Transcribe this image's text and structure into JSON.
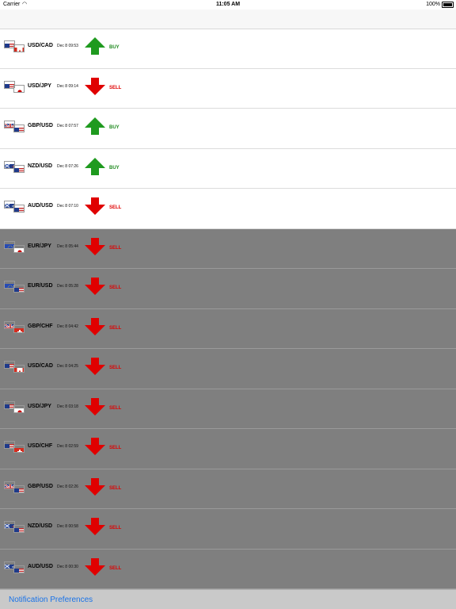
{
  "status": {
    "carrier": "Carrier",
    "time": "11:05 AM",
    "battery": "100%"
  },
  "signals": [
    {
      "pair": "USD/CAD",
      "time": "Dec 8 09:53",
      "signal": "BUY",
      "flags": [
        "us",
        "ca"
      ]
    },
    {
      "pair": "USD/JPY",
      "time": "Dec 8 09:14",
      "signal": "SELL",
      "flags": [
        "us",
        "jp"
      ]
    },
    {
      "pair": "GBP/USD",
      "time": "Dec 8 07:57",
      "signal": "BUY",
      "flags": [
        "gb",
        "us"
      ]
    },
    {
      "pair": "NZD/USD",
      "time": "Dec 8 07:26",
      "signal": "BUY",
      "flags": [
        "nz",
        "us"
      ]
    },
    {
      "pair": "AUD/USD",
      "time": "Dec 8 07:10",
      "signal": "SELL",
      "flags": [
        "au",
        "us"
      ]
    },
    {
      "pair": "EUR/JPY",
      "time": "Dec 8 05:44",
      "signal": "SELL",
      "flags": [
        "eu",
        "jp"
      ]
    },
    {
      "pair": "EUR/USD",
      "time": "Dec 8 05:28",
      "signal": "SELL",
      "flags": [
        "eu",
        "us"
      ]
    },
    {
      "pair": "GBP/CHF",
      "time": "Dec 8 04:42",
      "signal": "SELL",
      "flags": [
        "gb",
        "ch"
      ]
    },
    {
      "pair": "USD/CAD",
      "time": "Dec 8 04:25",
      "signal": "SELL",
      "flags": [
        "us",
        "ca"
      ]
    },
    {
      "pair": "USD/JPY",
      "time": "Dec 8 03:18",
      "signal": "SELL",
      "flags": [
        "us",
        "jp"
      ]
    },
    {
      "pair": "USD/CHF",
      "time": "Dec 8 02:59",
      "signal": "SELL",
      "flags": [
        "us",
        "ch"
      ]
    },
    {
      "pair": "GBP/USD",
      "time": "Dec 8 02:26",
      "signal": "SELL",
      "flags": [
        "gb",
        "us"
      ]
    },
    {
      "pair": "NZD/USD",
      "time": "Dec 8 00:58",
      "signal": "SELL",
      "flags": [
        "nz",
        "us"
      ]
    },
    {
      "pair": "AUD/USD",
      "time": "Dec 8 00:30",
      "signal": "SELL",
      "flags": [
        "au",
        "us"
      ]
    }
  ],
  "dimmed_from_index": 5,
  "colors": {
    "buy": "#1f9a1f",
    "sell": "#e00000",
    "link": "#1a73e8",
    "dim_overlay": "#7f7f7f"
  },
  "footer": {
    "preferences_label": "Notification Preferences"
  }
}
